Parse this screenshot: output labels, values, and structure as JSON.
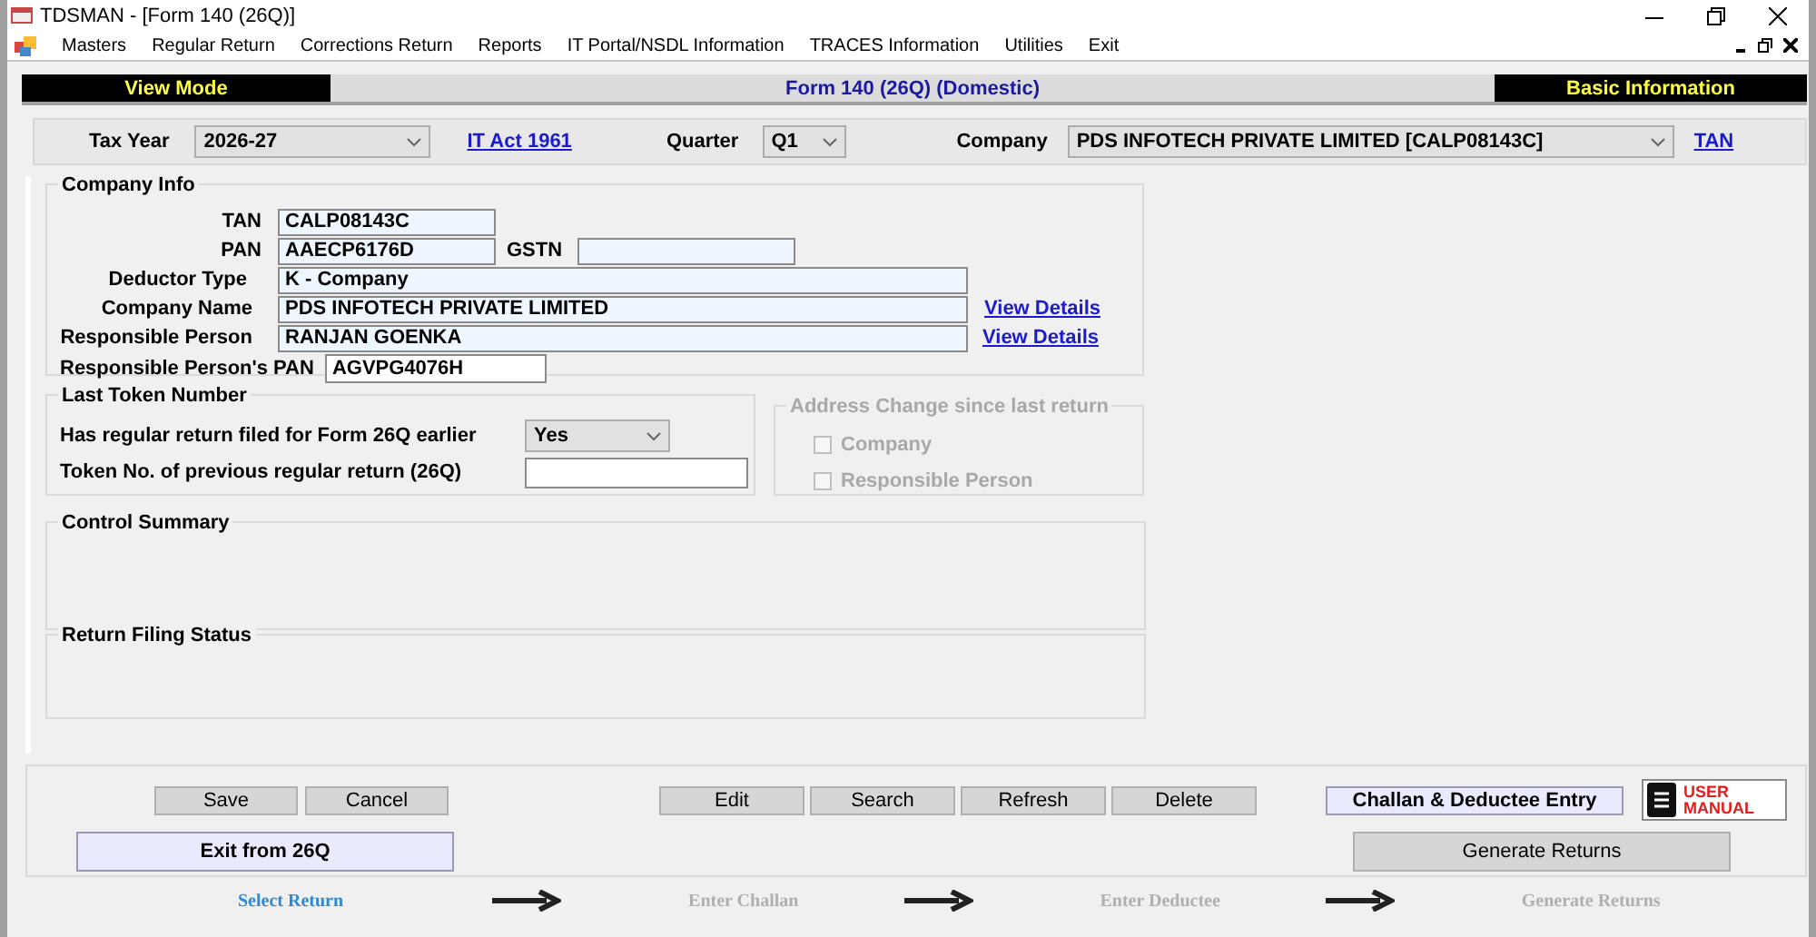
{
  "window": {
    "title": "TDSMAN - [Form 140 (26Q)]"
  },
  "menu": [
    "Masters",
    "Regular Return",
    "Corrections Return",
    "Reports",
    "IT Portal/NSDL Information",
    "TRACES Information",
    "Utilities",
    "Exit"
  ],
  "mode_bar": {
    "mode": "View Mode",
    "form": "Form 140 (26Q) (Domestic)",
    "section": "Basic Information"
  },
  "filters": {
    "tax_year_label": "Tax Year",
    "tax_year": "2026-27",
    "act_link": "IT Act 1961",
    "quarter_label": "Quarter",
    "quarter": "Q1",
    "company_label": "Company",
    "company": "PDS INFOTECH PRIVATE LIMITED [CALP08143C]",
    "tan_link": "TAN"
  },
  "company_info": {
    "title": "Company Info",
    "tan": {
      "label": "TAN",
      "value": "CALP08143C"
    },
    "pan": {
      "label": "PAN",
      "value": "AAECP6176D"
    },
    "gstn": {
      "label": "GSTN"
    },
    "deductor_type": {
      "label": "Deductor Type",
      "value": "K - Company"
    },
    "company_name": {
      "label": "Company Name",
      "value": "PDS INFOTECH PRIVATE LIMITED",
      "link": "View Details"
    },
    "responsible_person": {
      "label": "Responsible Person",
      "value": "RANJAN  GOENKA",
      "link": "View Details"
    },
    "responsible_pan": {
      "label": "Responsible Person's PAN",
      "value": "AGVPG4076H"
    }
  },
  "last_token": {
    "title": "Last Token Number",
    "filed_label": "Has regular return filed for Form 26Q earlier",
    "filed": "Yes",
    "token_label": "Token No. of previous regular return (26Q)"
  },
  "address_change": {
    "title": "Address Change since last return",
    "disabled": true,
    "options": [
      {
        "label": "Company",
        "checked": false
      },
      {
        "label": "Responsible Person",
        "checked": false
      }
    ]
  },
  "control_summary": {
    "title": "Control Summary"
  },
  "return_filing_status": {
    "title": "Return Filing Status"
  },
  "record_buttons": [
    "Save",
    "Cancel"
  ],
  "edit_buttons": [
    "Edit",
    "Search",
    "Refresh",
    "Delete"
  ],
  "challan_button": "Challan & Deductee Entry",
  "user_manual": {
    "line1": "USER",
    "line2": "MANUAL"
  },
  "exit_button": "Exit from 26Q",
  "generate_button": "Generate Returns",
  "steps": [
    {
      "label": "Select Return",
      "selected": true
    },
    {
      "label": "Enter Challan",
      "selected": false
    },
    {
      "label": "Enter Deductee",
      "selected": false
    },
    {
      "label": "Generate Returns",
      "selected": false
    }
  ]
}
